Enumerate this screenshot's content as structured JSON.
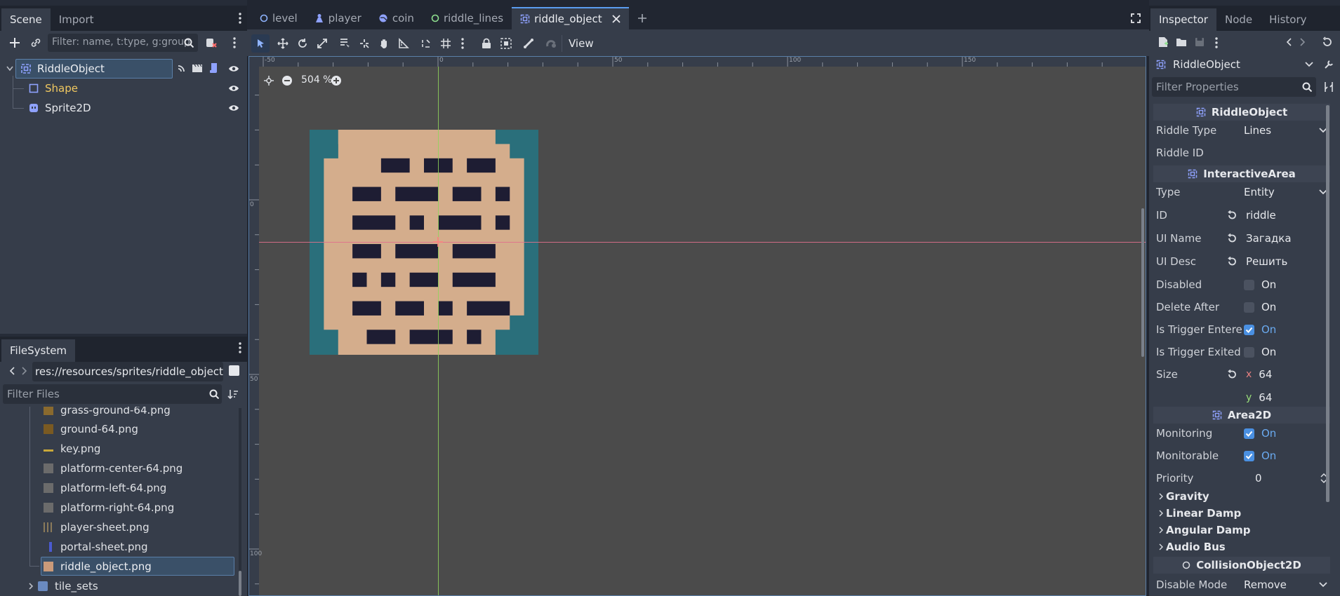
{
  "left_dock": {
    "tabs": [
      "Scene",
      "Import"
    ],
    "scene_filter_placeholder": "Filter: name, t:type, g:group",
    "tree": [
      {
        "label": "RiddleObject",
        "icon": "area2d-icon"
      },
      {
        "label": "Shape",
        "icon": "shape-icon"
      },
      {
        "label": "Sprite2D",
        "icon": "sprite2d-icon"
      }
    ],
    "filesystem_tab": "FileSystem",
    "path": "res://resources/sprites/riddle_object.pn",
    "filter_files_placeholder": "Filter Files",
    "files": [
      {
        "name": "grass-ground-64.png",
        "color": "#8a6a2e"
      },
      {
        "name": "ground-64.png",
        "color": "#7a5a22"
      },
      {
        "name": "key.png",
        "color": "#c9a83a"
      },
      {
        "name": "platform-center-64.png",
        "color": "#6b6b6b"
      },
      {
        "name": "platform-left-64.png",
        "color": "#6b6b6b"
      },
      {
        "name": "platform-right-64.png",
        "color": "#6b6b6b"
      },
      {
        "name": "player-sheet.png",
        "color": "#8a7a5a"
      },
      {
        "name": "portal-sheet.png",
        "color": "#4a5ad0"
      },
      {
        "name": "riddle_object.png",
        "color": "#c99a7a"
      },
      {
        "name": "tile_sets",
        "color": "#6a8ac0"
      }
    ]
  },
  "editor": {
    "tabs": [
      {
        "label": "level",
        "icon": "circle-icon",
        "color": "#8fb4ff"
      },
      {
        "label": "player",
        "icon": "person-icon",
        "color": "#8fa2ff"
      },
      {
        "label": "coin",
        "icon": "globe-icon",
        "color": "#8fa2ff"
      },
      {
        "label": "riddle_lines",
        "icon": "circle-icon",
        "color": "#8fe08f"
      },
      {
        "label": "riddle_object",
        "icon": "area2d-icon",
        "color": "#8fa2ff"
      }
    ],
    "view_label": "View",
    "zoom": "504 %",
    "ruler_labels": [
      "-50",
      "0",
      "50",
      "100",
      "150"
    ],
    "ruler_v_labels": [
      "0",
      "50",
      "100"
    ]
  },
  "inspector": {
    "tabs": [
      "Inspector",
      "Node",
      "History"
    ],
    "object_name": "RiddleObject",
    "filter_placeholder": "Filter Properties",
    "sections": {
      "riddle": "RiddleObject",
      "interactive": "InteractiveArea",
      "area2d": "Area2D",
      "collision": "CollisionObject2D"
    },
    "props": {
      "riddle_type_label": "Riddle Type",
      "riddle_type_value": "Lines",
      "riddle_id_label": "Riddle ID",
      "type_label": "Type",
      "type_value": "Entity",
      "id_label": "ID",
      "id_value": "riddle",
      "ui_name_label": "UI Name",
      "ui_name_value": "Загадка",
      "ui_desc_label": "UI Desc",
      "ui_desc_value": "Решить",
      "disabled_label": "Disabled",
      "delete_after_label": "Delete After",
      "trigger_entered_label": "Is Trigger Entere",
      "trigger_exited_label": "Is Trigger Exited",
      "size_label": "Size",
      "size_x_axis": "x",
      "size_x": "64",
      "size_y_axis": "y",
      "size_y": "64",
      "monitoring_label": "Monitoring",
      "monitorable_label": "Monitorable",
      "priority_label": "Priority",
      "priority_value": "0",
      "on": "On",
      "disable_mode_label": "Disable Mode",
      "disable_mode_value": "Remove"
    },
    "groups": [
      "Gravity",
      "Linear Damp",
      "Angular Damp",
      "Audio Bus"
    ]
  }
}
